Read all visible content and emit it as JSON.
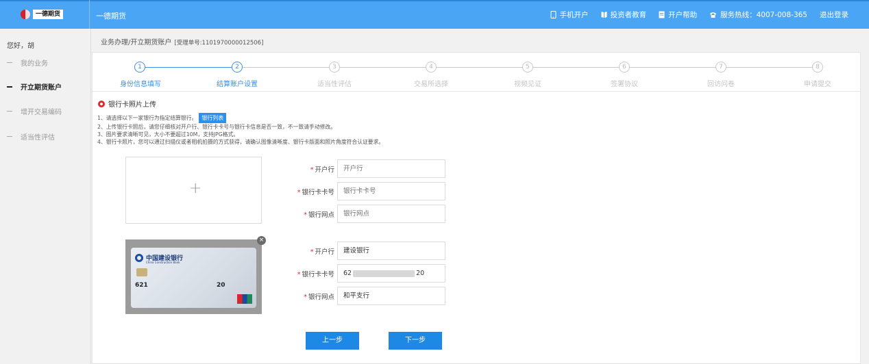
{
  "header": {
    "logo_text": "一德期货",
    "brand": "一德期货",
    "nav": {
      "mobile": "手机开户",
      "education": "投资者教育",
      "help": "开户帮助",
      "hotline": "服务热线：4007-008-365",
      "logout": "退出登录"
    }
  },
  "sidebar": {
    "greeting": "您好，胡",
    "items": [
      {
        "label": "我的业务"
      },
      {
        "label": "开立期货账户"
      },
      {
        "label": "增开交易编码"
      },
      {
        "label": "适当性评估"
      }
    ]
  },
  "breadcrumb": {
    "path": "业务办理/开立期货账户",
    "number": "[受理单号:1101970000012506]"
  },
  "steps": [
    {
      "num": "1",
      "label": "身份信息填写"
    },
    {
      "num": "2",
      "label": "结算账户设置"
    },
    {
      "num": "3",
      "label": "适当性评估"
    },
    {
      "num": "4",
      "label": "交易所选择"
    },
    {
      "num": "5",
      "label": "视频见证"
    },
    {
      "num": "6",
      "label": "签署协议"
    },
    {
      "num": "7",
      "label": "回访问卷"
    },
    {
      "num": "8",
      "label": "申请提交"
    }
  ],
  "section": {
    "title": "银行卡照片上传",
    "note1": "1、请选择以下一家银行为指定结算银行。",
    "bank_list_btn": "银行列表",
    "note2": "2、上传银行卡照后，请您仔细核对开户行、银行卡卡号与银行卡信息是否一致，不一致请手动修改。",
    "note3": "3、图片要求清晰可见，大小不要超过10M，支持JPG格式。",
    "note4": "4、银行卡照片，您可以通过扫描仪或者相机拍摄的方式获得，请确认图像清晰度、银行卡版面和照片角度符合认证要求。"
  },
  "upload": {
    "plus": "+"
  },
  "card_image": {
    "bank_name": "中国建设银行",
    "bank_en": "China Construction Bank",
    "num_start": "621",
    "num_end": "20",
    "close": "×"
  },
  "form1": {
    "bank_label": "开户行",
    "bank_placeholder": "开户行",
    "card_label": "银行卡卡号",
    "card_placeholder": "银行卡卡号",
    "branch_label": "银行网点",
    "branch_placeholder": "银行网点"
  },
  "form2": {
    "bank_label": "开户行",
    "bank_value": "建设银行",
    "card_label": "银行卡卡号",
    "card_start": "62",
    "card_end": "20",
    "branch_label": "银行网点",
    "branch_value": "和平支行"
  },
  "buttons": {
    "prev": "上一步",
    "next": "下一步"
  },
  "colors": {
    "header_bg": "#4aa6f5",
    "accent": "#3d8fe0",
    "required": "#e0292c",
    "button": "#1e88e5"
  }
}
